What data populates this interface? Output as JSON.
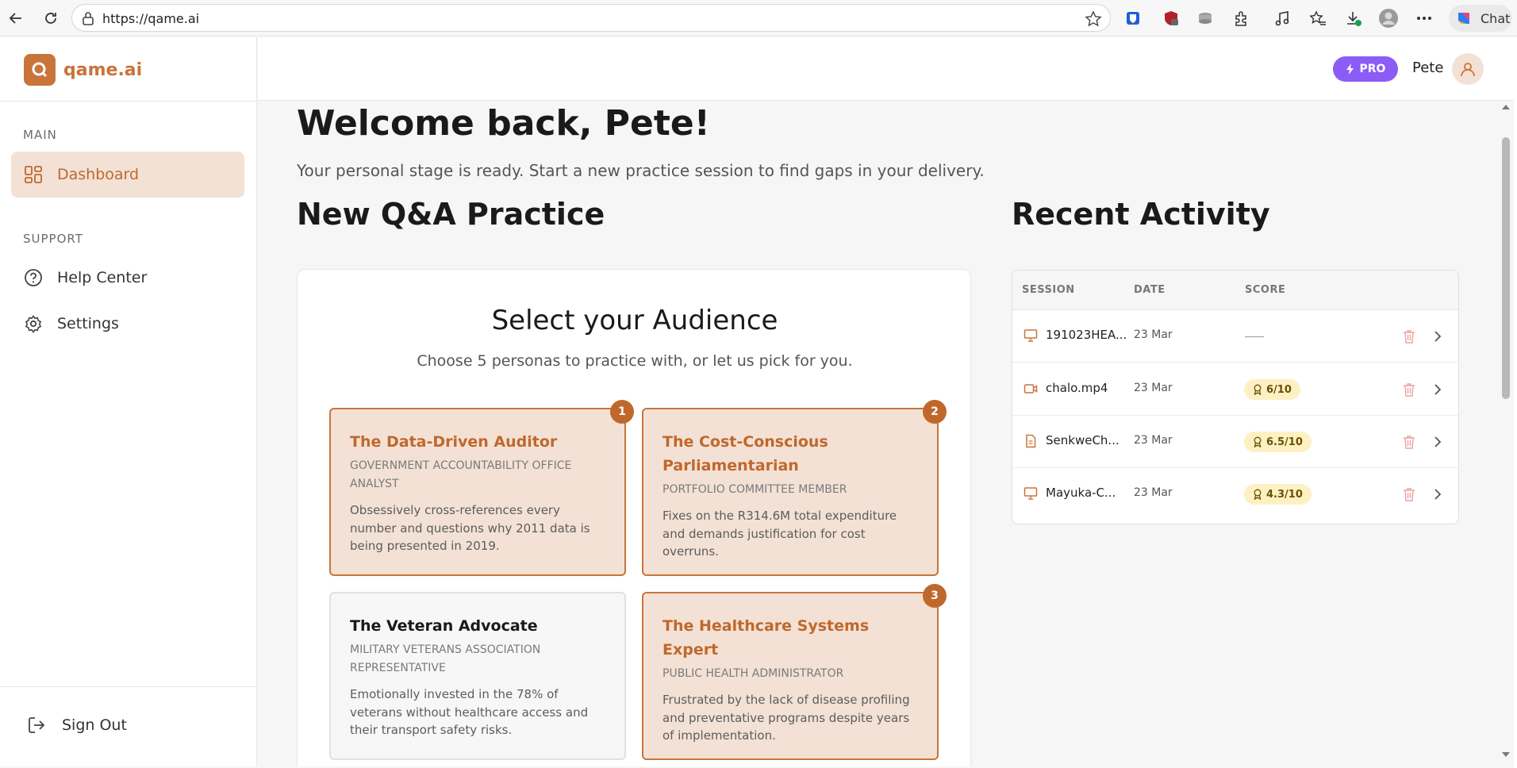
{
  "browser": {
    "url": "https://qame.ai",
    "chat_label": "Chat"
  },
  "app": {
    "brand": "qame.ai",
    "pro_label": "PRO",
    "user_name": "Pete"
  },
  "sidebar": {
    "main_label": "MAIN",
    "support_label": "SUPPORT",
    "items": [
      {
        "label": "Dashboard",
        "icon": "dashboard-icon",
        "active": true
      },
      {
        "label": "Help Center",
        "icon": "help-icon",
        "active": false
      },
      {
        "label": "Settings",
        "icon": "gear-icon",
        "active": false
      }
    ],
    "sign_out": "Sign Out"
  },
  "main": {
    "welcome": "Welcome back, Pete!",
    "subtitle": "Your personal stage is ready. Start a new practice session to find gaps in your delivery.",
    "practice_heading": "New Q&A Practice",
    "activity_heading": "Recent Activity"
  },
  "audience": {
    "title": "Select your Audience",
    "subtitle": "Choose 5 personas to practice with, or let us pick for you.",
    "personas": [
      {
        "name": "The Data-Driven Auditor",
        "role": "Government Accountability Office Analyst",
        "description": "Obsessively cross-references every number and questions why 2011 data is being presented in 2019.",
        "selected": true,
        "order": "1"
      },
      {
        "name": "The Cost-Conscious Parliamentarian",
        "role": "Portfolio Committee Member",
        "description": "Fixes on the R314.6M total expenditure and demands justification for cost overruns.",
        "selected": true,
        "order": "2"
      },
      {
        "name": "The Veteran Advocate",
        "role": "Military Veterans Association Representative",
        "description": "Emotionally invested in the 78% of veterans without healthcare access and their transport safety risks.",
        "selected": false,
        "order": ""
      },
      {
        "name": "The Healthcare Systems Expert",
        "role": "Public Health Administrator",
        "description": "Frustrated by the lack of disease profiling and preventative programs despite years of implementation.",
        "selected": true,
        "order": "3"
      }
    ]
  },
  "activity": {
    "columns": [
      "SESSION",
      "DATE",
      "SCORE"
    ],
    "rows": [
      {
        "session": "191023HEA...",
        "icon": "presentation-icon",
        "date": "23 Mar",
        "score": ""
      },
      {
        "session": "chalo.mp4",
        "icon": "video-icon",
        "date": "23 Mar",
        "score": "6/10"
      },
      {
        "session": "SenkweCh...",
        "icon": "document-icon",
        "date": "23 Mar",
        "score": "6.5/10"
      },
      {
        "session": "Mayuka-C...",
        "icon": "presentation-icon",
        "date": "23 Mar",
        "score": "4.3/10"
      }
    ]
  },
  "colors": {
    "accent": "#c9743b",
    "accent_bg": "#f3e1d5",
    "pro": "#8b5cf6",
    "score_bg": "#fdf1c4"
  }
}
